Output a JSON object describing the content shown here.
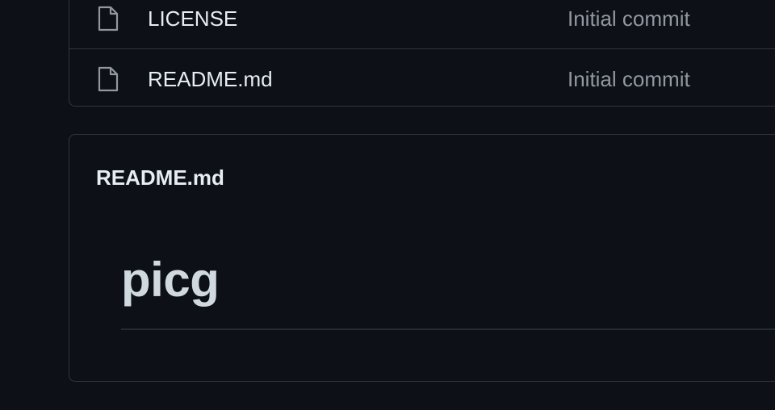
{
  "files": [
    {
      "icon": "file-icon",
      "name": "LICENSE",
      "commit": "Initial commit"
    },
    {
      "icon": "file-icon",
      "name": "README.md",
      "commit": "Initial commit"
    }
  ],
  "readme": {
    "header": "README.md",
    "heading": "picg"
  },
  "colors": {
    "background": "#0d1117",
    "border": "#30363d",
    "text": "#e6edf3",
    "muted": "#9198a1"
  }
}
